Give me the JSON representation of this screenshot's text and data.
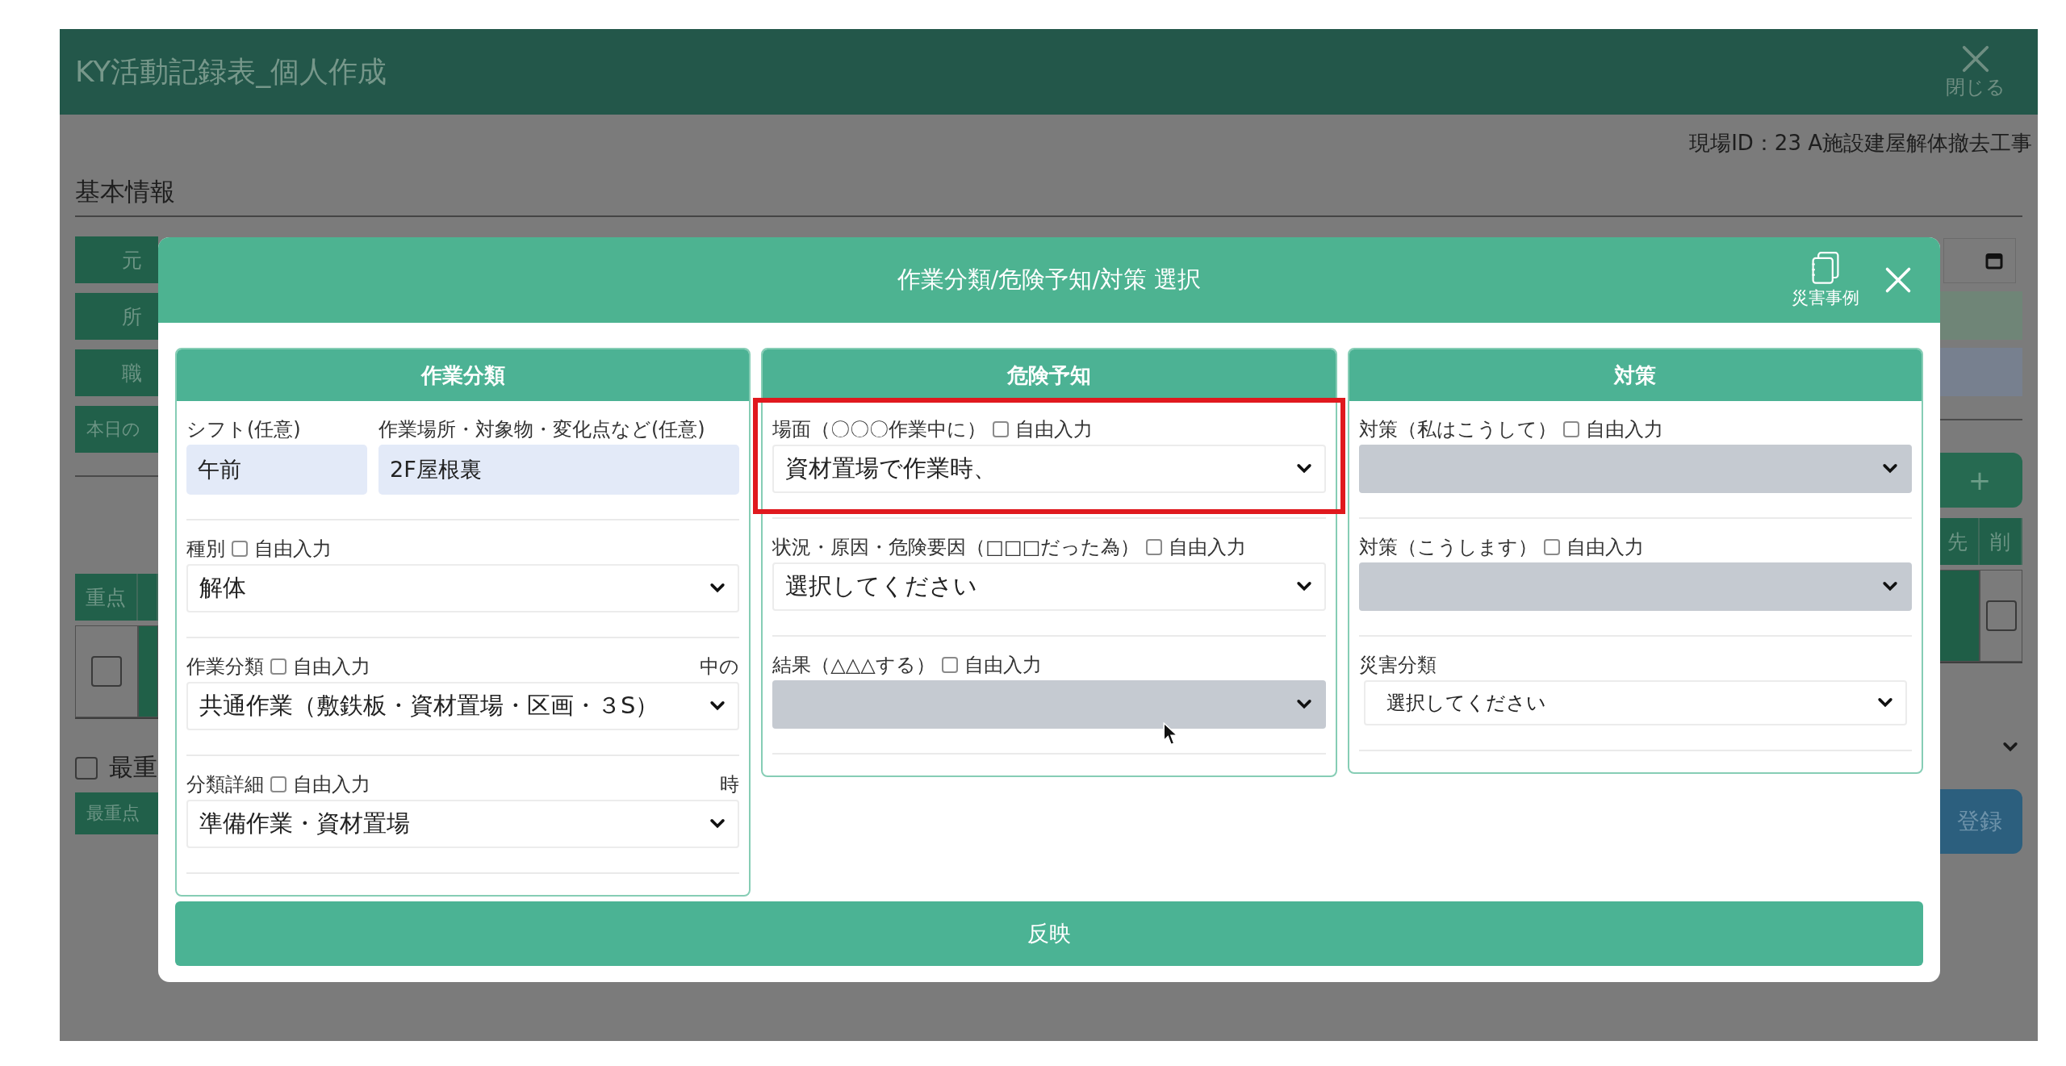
{
  "app": {
    "title": "KY活動記録表_個人作成",
    "close_label": "閉じる",
    "site_id": "現場ID：23 A施設建屋解体撤去工事",
    "section_title": "基本情報",
    "side_labels": [
      "元",
      "所",
      "職",
      "本日の"
    ],
    "table": {
      "columns": [
        "重点",
        "先",
        "削"
      ],
      "row": {
        "checked": false,
        "delete_checked": false
      }
    },
    "priority_check": {
      "label": "最重",
      "checked": false
    },
    "priority_button": "最重点",
    "add_button": "+",
    "register_button": "登録"
  },
  "modal": {
    "title": "作業分類/危険予知/対策 選択",
    "examples_label": "災害事例",
    "panels": [
      {
        "title": "作業分類",
        "fields": [
          {
            "kind": "inputs",
            "highlighted": false,
            "inputs": [
              {
                "label": "シフト(任意)",
                "value": "午前"
              },
              {
                "label": "作業場所・対象物・変化点など(任意)",
                "value": "2F屋根裏"
              }
            ]
          },
          {
            "kind": "select",
            "highlighted": false,
            "label": "種別",
            "free_input": {
              "label": "自由入力",
              "checked": false
            },
            "value": "解体",
            "disabled": false
          },
          {
            "kind": "select",
            "highlighted": false,
            "label": "作業分類",
            "free_input": {
              "label": "自由入力",
              "checked": false
            },
            "note": "中の",
            "value": "共通作業（敷鉄板・資材置場・区画・３S）",
            "disabled": false
          },
          {
            "kind": "select",
            "highlighted": false,
            "label": "分類詳細",
            "free_input": {
              "label": "自由入力",
              "checked": false
            },
            "note": "時",
            "value": "準備作業・資材置場",
            "disabled": false
          }
        ]
      },
      {
        "title": "危険予知",
        "fields": [
          {
            "kind": "select",
            "highlighted": true,
            "label": "場面（〇〇〇作業中に）",
            "free_input": {
              "label": "自由入力",
              "checked": false
            },
            "value": "資材置場で作業時、",
            "disabled": false
          },
          {
            "kind": "select",
            "highlighted": false,
            "label": "状況・原因・危険要因（□□□だった為）",
            "free_input": {
              "label": "自由入力",
              "checked": false
            },
            "value": "選択してください",
            "disabled": false
          },
          {
            "kind": "select",
            "highlighted": false,
            "label": "結果（△△△する）",
            "free_input": {
              "label": "自由入力",
              "checked": false
            },
            "disabled": true
          }
        ]
      },
      {
        "title": "対策",
        "fields": [
          {
            "kind": "select",
            "highlighted": false,
            "label": "対策（私はこうして）",
            "free_input": {
              "label": "自由入力",
              "checked": false
            },
            "disabled": true
          },
          {
            "kind": "select",
            "highlighted": false,
            "label": "対策（こうします）",
            "free_input": {
              "label": "自由入力",
              "checked": false
            },
            "disabled": true
          },
          {
            "kind": "select",
            "highlighted": false,
            "label": "災害分類",
            "value": "選択してください",
            "disabled": false
          }
        ]
      }
    ],
    "apply_button": "反映"
  }
}
